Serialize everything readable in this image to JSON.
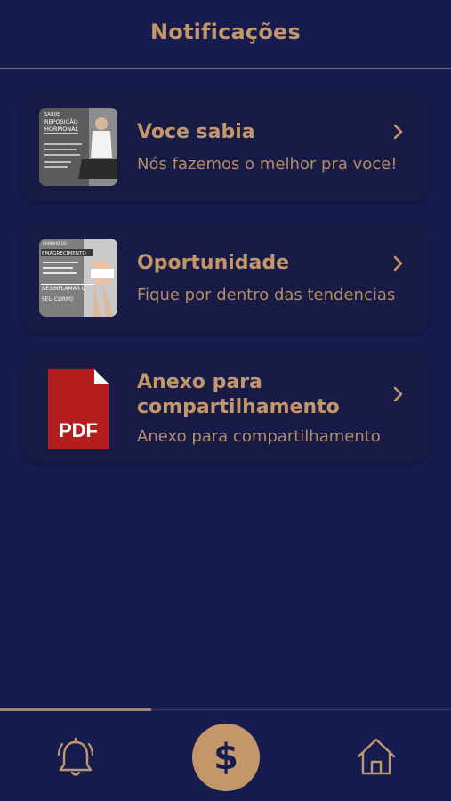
{
  "header": {
    "title": "Notificações"
  },
  "notifications": [
    {
      "title": "Voce sabia",
      "subtitle": "Nós fazemos o melhor pra voce!",
      "thumb_label_top": "REPOSIÇÃO",
      "thumb_label_bottom": "HORMONAL",
      "thumb_label_small": "SAÚDE"
    },
    {
      "title": "Oportunidade",
      "subtitle": "Fique por dentro das tendencias",
      "thumb_label_top": "EMAGRECIMENTO",
      "thumb_label_bottom": "DESINFLAMAR O",
      "thumb_label_bottom2": "SEU CORPO"
    },
    {
      "title": "Anexo para compartilhamento",
      "subtitle": "Anexo para compartilhamento",
      "thumb_label": "PDF"
    }
  ],
  "tabbar": {
    "tabs": [
      {
        "icon": "bell-icon"
      },
      {
        "icon": "dollar-icon",
        "label": "$"
      },
      {
        "icon": "home-icon"
      }
    ]
  },
  "colors": {
    "background": "#161c4f",
    "card": "#171b45",
    "accent": "#c4976a",
    "pdf_red": "#b41e1e"
  }
}
